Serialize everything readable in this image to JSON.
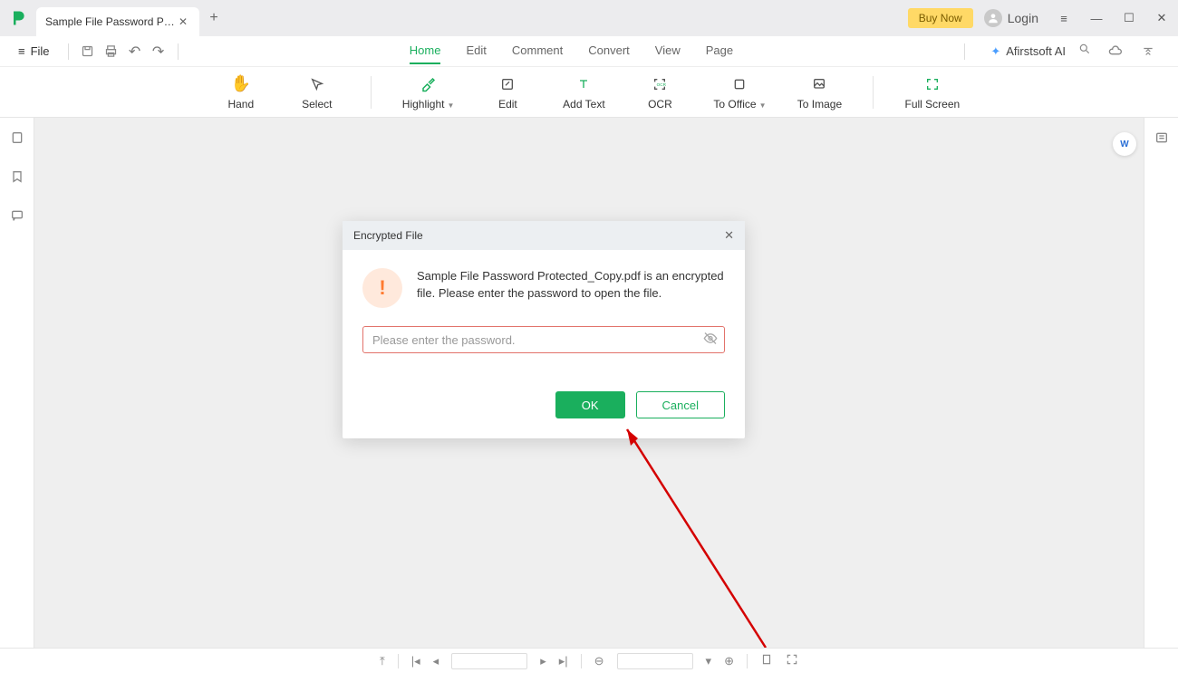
{
  "titlebar": {
    "tab_title": "Sample File Password Pr...",
    "buy_now": "Buy Now",
    "login": "Login"
  },
  "menubar": {
    "file": "File",
    "tabs": {
      "home": "Home",
      "edit": "Edit",
      "comment": "Comment",
      "convert": "Convert",
      "view": "View",
      "page": "Page"
    },
    "ai": "Afirstsoft AI"
  },
  "toolbar": {
    "hand": "Hand",
    "select": "Select",
    "highlight": "Highlight",
    "edit": "Edit",
    "add_text": "Add Text",
    "ocr": "OCR",
    "to_office": "To Office",
    "to_image": "To Image",
    "full_screen": "Full Screen"
  },
  "dialog": {
    "title": "Encrypted File",
    "message": "Sample File Password Protected_Copy.pdf is an encrypted file. Please enter the password to open the file.",
    "placeholder": "Please enter the password.",
    "ok": "OK",
    "cancel": "Cancel"
  },
  "word_badge": "W"
}
